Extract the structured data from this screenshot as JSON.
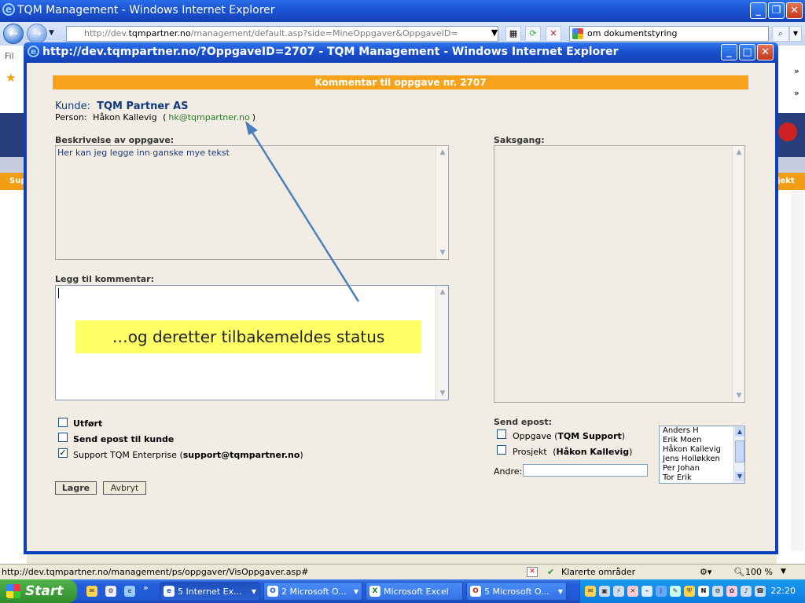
{
  "outer_window": {
    "title": "TQM Management - Windows Internet Explorer",
    "address_prefix": "http://dev.",
    "address_domain": "tqmpartner.no",
    "address_path": "/management/default.asp?side=MineOppgaver&OppgaveID=",
    "search_text": "om dokumentstyring",
    "menu_stub": "Fil"
  },
  "popup_window": {
    "title": "http://dev.tqmpartner.no/?OppgaveID=2707 - TQM Management - Windows Internet Explorer"
  },
  "form": {
    "header": "Kommentar til oppgave nr. 2707",
    "kunde_label": "Kunde:",
    "kunde_value": "TQM Partner AS",
    "person_label": "Person:",
    "person_value": "Håkon Kallevig",
    "person_email": "hk@tqmpartner.no",
    "beskrivelse_label": "Beskrivelse av oppgave:",
    "beskrivelse_value": "Her kan jeg legge inn ganske mye tekst",
    "saksgang_label": "Saksgang:",
    "kommentar_label": "Legg til kommentar:",
    "callout": "…og deretter tilbakemeldes status",
    "utfort_label": "Utført",
    "send_kunde_label": "Send epost til kunde",
    "support_label": "Support TQM Enterprise",
    "support_email": "support@tqmpartner.no",
    "save_label": "Lagre",
    "cancel_label": "Avbryt",
    "send_epost_label": "Send epost:",
    "oppgave_label": "Oppgave",
    "oppgave_value": "TQM Support",
    "prosjekt_label": "Prosjekt",
    "prosjekt_value": "Håkon Kallevig",
    "andre_label": "Andre:",
    "recipients": [
      "Anders H",
      "Erik Moen",
      "Håkon Kallevig",
      "Jens Holløkken",
      "Per Johan",
      "Tor Erik"
    ]
  },
  "background_page": {
    "left_tab_stub": "Sup",
    "right_tab_stub": "jekt"
  },
  "statusbar": {
    "url": "http://dev.tqmpartner.no/management/ps/oppgaver/VisOppgaver.asp#",
    "zone": "Klarerte områder",
    "zoom": "100 %"
  },
  "taskbar": {
    "start_label": "Start",
    "tasks": [
      "5 Internet Ex...",
      "2 Microsoft O...",
      "Microsoft Excel",
      "5 Microsoft O..."
    ],
    "clock": "22:20"
  },
  "colors": {
    "accent_orange": "#f7a21b",
    "title_blue": "#1a50cf",
    "callout_yellow": "#ffff66",
    "arrow_blue": "#4a7fbf"
  }
}
